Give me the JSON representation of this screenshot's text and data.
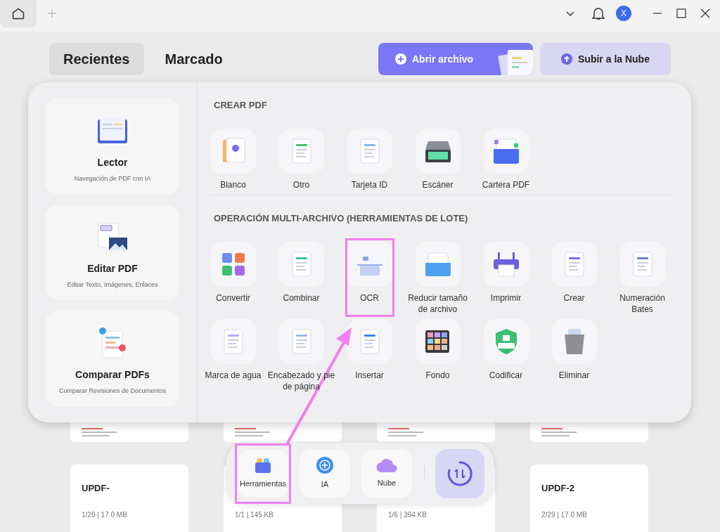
{
  "title_bar": {
    "avatar": "X"
  },
  "tabs": [
    {
      "label": "Recientes",
      "selected": true
    },
    {
      "label": "Marcado",
      "selected": false
    }
  ],
  "actions": [
    {
      "label": "Abrir archivo",
      "kind": "primary"
    },
    {
      "label": "Subir a la Nube",
      "kind": "secondary"
    }
  ],
  "files": [
    {
      "title": "UPDF-",
      "meta": "1/29 | 17.0 MB"
    },
    {
      "meta": "1/1 | 145 KB"
    },
    {
      "meta": "1/6 | 394 KB"
    },
    {
      "title": "UPDF-2",
      "meta": "2/29 | 17.0 MB"
    }
  ],
  "panel": {
    "features": [
      {
        "title": "Lector",
        "description": "Navegación de PDF con IA",
        "kind": "reader"
      },
      {
        "title": "Editar PDF",
        "description": "Editar Texto, Imágenes, Enlaces",
        "kind": "edit"
      },
      {
        "title": "Comparar PDFs",
        "description": "Comparar Revisiones de Documentos",
        "kind": "compare"
      }
    ],
    "sections": [
      {
        "heading": "CREAR PDF",
        "tools": [
          {
            "label": "Blanco",
            "kind": "blank",
            "highlighted": false
          },
          {
            "label": "Otro",
            "kind": "other",
            "highlighted": false
          },
          {
            "label": "Tarjeta ID",
            "kind": "idcard",
            "highlighted": false
          },
          {
            "label": "Escáner",
            "kind": "scanner",
            "highlighted": false
          },
          {
            "label": "Cartera PDF",
            "kind": "portfolio",
            "highlighted": false
          }
        ]
      },
      {
        "heading": "OPERACIÓN MULTI-ARCHIVO (HERRAMIENTAS DE LOTE)",
        "tools": [
          {
            "label": "Convertir",
            "kind": "convert",
            "highlighted": false
          },
          {
            "label": "Combinar",
            "kind": "combine",
            "highlighted": false
          },
          {
            "label": "OCR",
            "kind": "ocr",
            "highlighted": true
          },
          {
            "label": "Reducir tamaño de archivo",
            "kind": "compress",
            "highlighted": false
          },
          {
            "label": "Imprimir",
            "kind": "print",
            "highlighted": false
          },
          {
            "label": "Crear",
            "kind": "create",
            "highlighted": false
          },
          {
            "label": "Numeración Bates",
            "kind": "bates",
            "highlighted": false
          },
          {
            "label": "Marca de agua",
            "kind": "watermark",
            "highlighted": false
          },
          {
            "label": "Encabezado y pie de página",
            "kind": "header",
            "highlighted": false
          },
          {
            "label": "Insertar",
            "kind": "insert",
            "highlighted": false
          },
          {
            "label": "Fondo",
            "kind": "background",
            "highlighted": false
          },
          {
            "label": "Codificar",
            "kind": "encrypt",
            "highlighted": false
          },
          {
            "label": "Eliminar",
            "kind": "delete",
            "highlighted": false
          }
        ]
      }
    ]
  },
  "dock": [
    {
      "label": "Herramientas",
      "kind": "tools",
      "highlighted": true
    },
    {
      "label": "IA",
      "kind": "ai",
      "highlighted": false
    },
    {
      "label": "Nube",
      "kind": "cloud",
      "highlighted": false
    }
  ]
}
